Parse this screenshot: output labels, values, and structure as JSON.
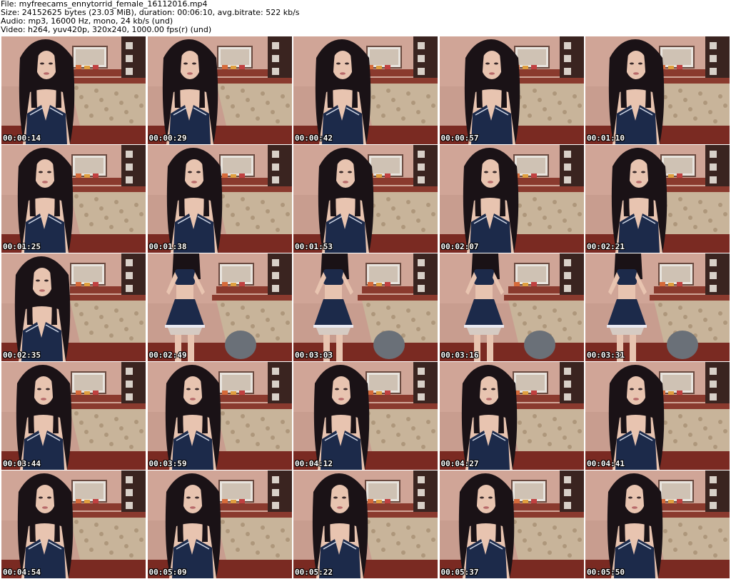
{
  "header": {
    "file": "File: myfreecams_ennytorrid_female_16112016.mp4",
    "size": "Size: 24152625 bytes (23.03 MiB), duration: 00:06:10, avg.bitrate: 522 kb/s",
    "audio": "Audio: mp3, 16000 Hz, mono, 24 kb/s (und)",
    "video": "Video: h264, yuv420p, 320x240, 1000.00 fps(r) (und)"
  },
  "thumbnails": [
    {
      "timestamp": "00:00:14",
      "pose": "seated"
    },
    {
      "timestamp": "00:00:29",
      "pose": "seated"
    },
    {
      "timestamp": "00:00:42",
      "pose": "seated"
    },
    {
      "timestamp": "00:00:57",
      "pose": "seated"
    },
    {
      "timestamp": "00:01:10",
      "pose": "seated"
    },
    {
      "timestamp": "00:01:25",
      "pose": "seated"
    },
    {
      "timestamp": "00:01:38",
      "pose": "seated"
    },
    {
      "timestamp": "00:01:53",
      "pose": "seated"
    },
    {
      "timestamp": "00:02:07",
      "pose": "seated"
    },
    {
      "timestamp": "00:02:21",
      "pose": "seated"
    },
    {
      "timestamp": "00:02:35",
      "pose": "seated"
    },
    {
      "timestamp": "00:02:49",
      "pose": "standing"
    },
    {
      "timestamp": "00:03:03",
      "pose": "standing"
    },
    {
      "timestamp": "00:03:16",
      "pose": "standing"
    },
    {
      "timestamp": "00:03:31",
      "pose": "standing"
    },
    {
      "timestamp": "00:03:44",
      "pose": "seated"
    },
    {
      "timestamp": "00:03:59",
      "pose": "seated"
    },
    {
      "timestamp": "00:04:12",
      "pose": "seated"
    },
    {
      "timestamp": "00:04:27",
      "pose": "seated"
    },
    {
      "timestamp": "00:04:41",
      "pose": "seated"
    },
    {
      "timestamp": "00:04:54",
      "pose": "seated"
    },
    {
      "timestamp": "00:05:09",
      "pose": "seated"
    },
    {
      "timestamp": "00:05:22",
      "pose": "seated"
    },
    {
      "timestamp": "00:05:37",
      "pose": "seated"
    },
    {
      "timestamp": "00:05:50",
      "pose": "seated"
    }
  ],
  "colors": {
    "wall": "#c89d8f",
    "floor": "#7a2a22",
    "bedspread": "#c8b49a",
    "bedframe": "#8a3a2e",
    "hair": "#1a1216",
    "skin": "#e8c4b0",
    "top": "#1c2a4a",
    "cabinet": "#3a2420",
    "screen": "#e8e4de",
    "timestamp": "#ffffff"
  }
}
